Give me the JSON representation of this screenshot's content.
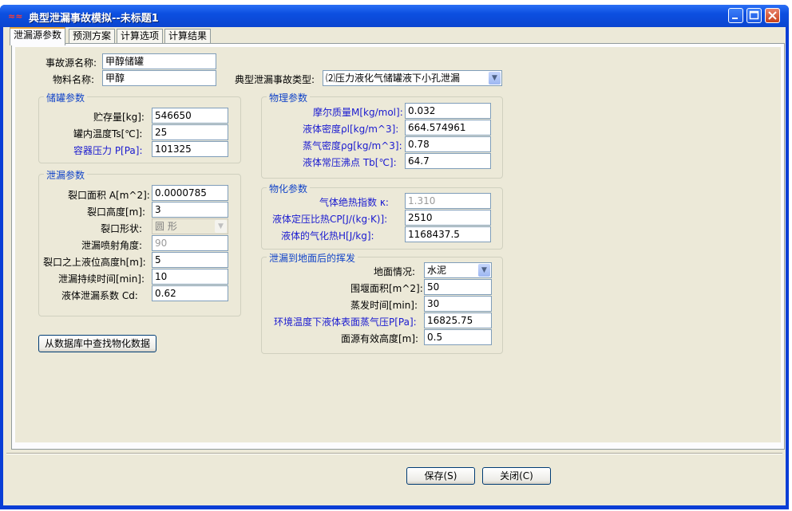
{
  "window": {
    "title": "典型泄漏事故模拟--未标题1"
  },
  "tabs": [
    "泄漏源参数",
    "预测方案",
    "计算选项",
    "计算结果"
  ],
  "top": {
    "source_name_label": "事故源名称:",
    "source_name": "甲醇储罐",
    "material_label": "物料名称:",
    "material": "甲醇",
    "type_label": "典型泄漏事故类型:",
    "type_value": "⑵压力液化气储罐液下小孔泄漏"
  },
  "tank": {
    "title": "储罐参数",
    "fields": [
      {
        "label": "贮存量[kg]:",
        "value": "546650"
      },
      {
        "label": "罐内温度Ts[℃]:",
        "value": "25"
      },
      {
        "label": "容器压力 P[Pa]:",
        "value": "101325"
      }
    ]
  },
  "leak": {
    "title": "泄漏参数",
    "fields": [
      {
        "label": "裂口面积 A[m^2]:",
        "value": "0.0000785"
      },
      {
        "label": "裂口高度[m]:",
        "value": "3"
      },
      {
        "label": "裂口形状:",
        "value": "圆   形"
      },
      {
        "label": "泄漏喷射角度:",
        "value": "90"
      },
      {
        "label": "裂口之上液位高度h[m]:",
        "value": "5"
      },
      {
        "label": "泄漏持续时间[min]:",
        "value": "10"
      },
      {
        "label": "液体泄漏系数   Cd:",
        "value": "0.62"
      }
    ]
  },
  "physical": {
    "title": "物理参数",
    "fields": [
      {
        "label": "摩尔质量M[kg/mol]:",
        "value": "0.032"
      },
      {
        "label": "液体密度ρl[kg/m^3]:",
        "value": "664.574961"
      },
      {
        "label": "蒸气密度ρg[kg/m^3]:",
        "value": "0.78"
      },
      {
        "label": "液体常压沸点 Tb[℃]:",
        "value": "64.7"
      }
    ]
  },
  "physchem": {
    "title": "物化参数",
    "fields": [
      {
        "label": "气体绝热指数  κ:",
        "value": "1.310"
      },
      {
        "label": "液体定压比热CP[J/(kg·K)]:",
        "value": "2510"
      },
      {
        "label": "液体的气化热H[J/kg]:",
        "value": "1168437.5"
      }
    ]
  },
  "evap": {
    "title": "泄漏到地面后的挥发",
    "fields": [
      {
        "label": "地面情况:",
        "value": "水泥"
      },
      {
        "label": "围堰面积[m^2]:",
        "value": "50"
      },
      {
        "label": "蒸发时间[min]:",
        "value": "30"
      },
      {
        "label": "环境温度下液体表面蒸气压P[Pa]:",
        "value": "16825.75"
      },
      {
        "label": "面源有效高度[m]:",
        "value": "0.5"
      }
    ]
  },
  "buttons": {
    "lookup": "从数据库中查找物化数据",
    "save": "保存(S)",
    "close": "关闭(C)"
  }
}
